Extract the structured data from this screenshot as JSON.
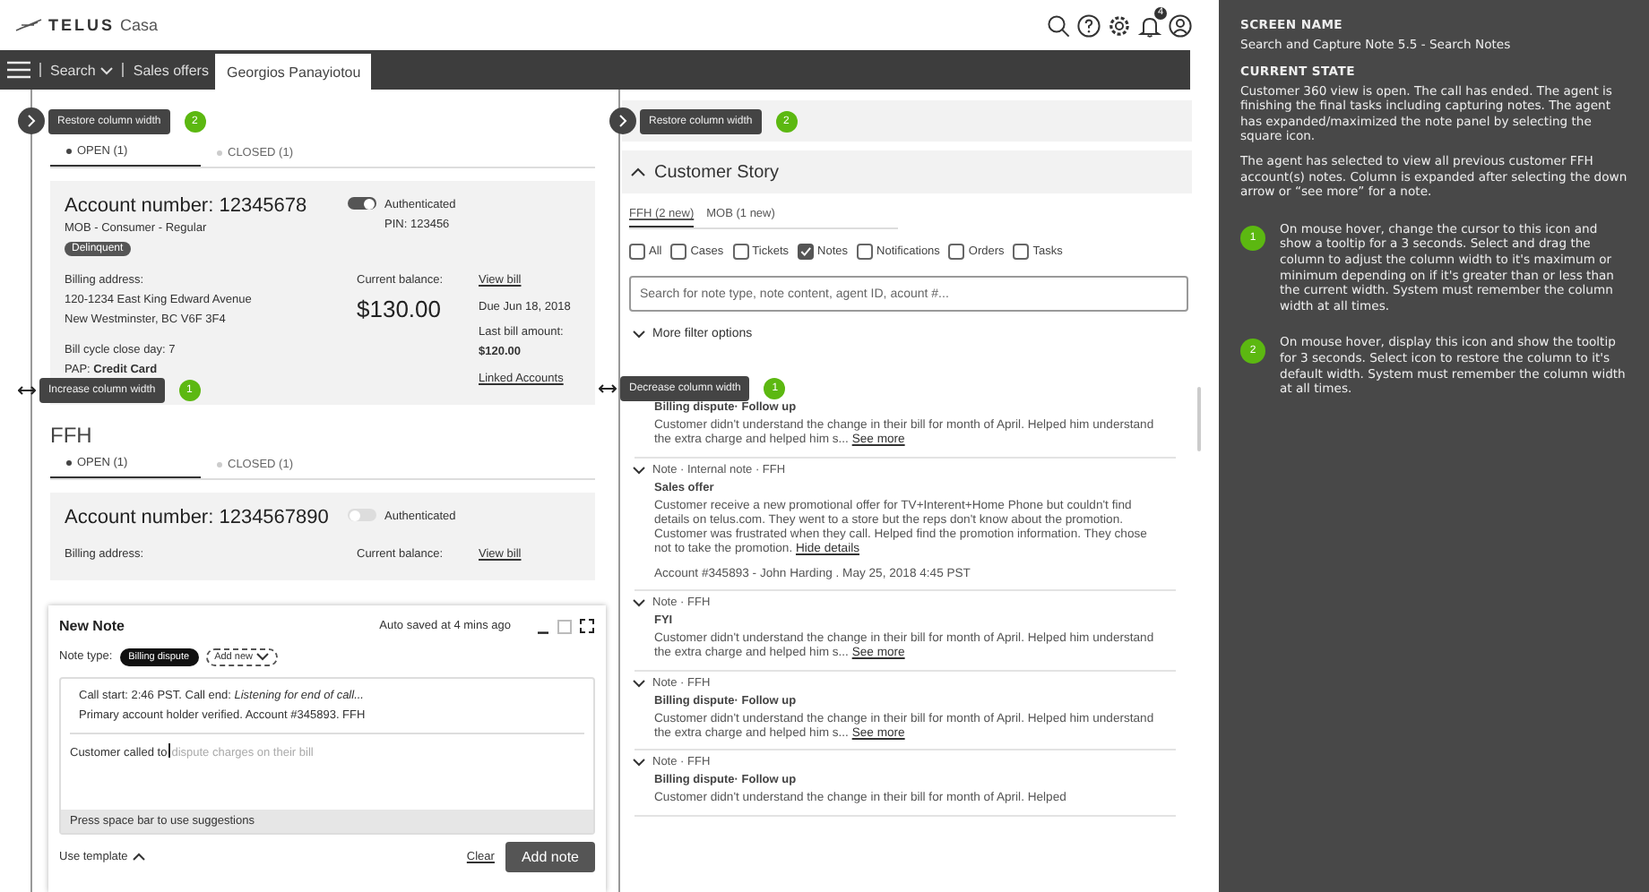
{
  "header": {
    "brand": "TELUS",
    "product": "Casa",
    "notification_count": "4"
  },
  "nav": {
    "search": "Search",
    "sales_offers": "Sales offers",
    "customer_tab": "Georgios Panayiotou"
  },
  "left_column": {
    "restore_tooltip": {
      "text": "Restore column width",
      "badge": "2"
    },
    "resize_tooltip": {
      "text": "Increase column width",
      "badge": "1"
    },
    "sections": [
      {
        "tabs": [
          {
            "label": "OPEN (1)",
            "selected": true
          },
          {
            "label": "CLOSED (1)",
            "selected": false
          }
        ],
        "account": {
          "number": "Account number: 12345678",
          "plan": "MOB - Consumer - Regular",
          "status_tag": "Delinquent",
          "authenticated": true,
          "auth_label": "Authenticated",
          "pin": "PIN: 123456",
          "billing_label": "Billing address:",
          "address": [
            "120-1234 East King Edward Avenue",
            "New Westminster, BC V6F 3F4"
          ],
          "bill_cycle": "Bill cycle close day: 7",
          "pap": "PAP: **Credit Card**",
          "balance_label": "Current balance:",
          "balance": "$130.00",
          "view_bill": "View bill",
          "due": "Due Jun 18, 2018",
          "last_bill_label": "Last bill amount:",
          "last_bill": "$120.00",
          "linked": "Linked Accounts"
        }
      },
      {
        "title": "FFH",
        "tabs": [
          {
            "label": "OPEN (1)",
            "selected": true
          },
          {
            "label": "CLOSED (1)",
            "selected": false
          }
        ],
        "account": {
          "number": "Account number: 1234567890",
          "authenticated": false,
          "auth_label": "Authenticated",
          "billing_label": "Billing address:",
          "balance_label": "Current balance:",
          "view_bill": "View bill"
        }
      }
    ],
    "new_note": {
      "title": "New Note",
      "autosave": "Auto saved at 4 mins ago",
      "note_type_label": "Note type:",
      "type_chip": "Billing dispute",
      "add_new": "Add new",
      "lines": [
        "Call start: 2:46 PST. Call end: *Listening for end of call...*",
        "Primary account holder verified. Account #345893. FFH"
      ],
      "typed": "Customer called to",
      "suggestion": "dispute charges on their bill",
      "hint": "Press space bar to use suggestions",
      "use_template": "Use template",
      "clear": "Clear",
      "add_note": "Add note"
    }
  },
  "right_column": {
    "restore_tooltip": {
      "text": "Restore column width",
      "badge": "2"
    },
    "resize_tooltip": {
      "text": "Decrease column width",
      "badge": "1"
    },
    "story": {
      "title": "Customer Story",
      "expanded": true
    },
    "tabs": [
      {
        "label": "FFH (2 new)",
        "selected": true
      },
      {
        "label": "MOB (1 new)",
        "selected": false
      }
    ],
    "filters": [
      {
        "label": "All",
        "checked": false
      },
      {
        "label": "Cases",
        "checked": false
      },
      {
        "label": "Tickets",
        "checked": false
      },
      {
        "label": "Notes",
        "checked": true
      },
      {
        "label": "Notifications",
        "checked": false
      },
      {
        "label": "Orders",
        "checked": false
      },
      {
        "label": "Tasks",
        "checked": false
      }
    ],
    "search": {
      "placeholder": "Search for note type, note content, agent ID, acount #..."
    },
    "more_filters": "More filter options",
    "notes": [
      {
        "title": "Billing dispute· Follow up",
        "text": "Customer didn't understand the change in their bill for month of April. Helped him understand the extra charge and helped him s...",
        "link": "See more"
      },
      {
        "header": "Note · Internal note · FFH",
        "title": "Sales offer",
        "text": "Customer receive a new promotional offer for TV+Interent+Home Phone but couldn't find details on telus.com. They went to a store but the reps don't know about the promotion. Customer was frustrated when they call. Helped find the promotion information. They chose not to take the promotion.",
        "link": "Hide details",
        "meta": "Account #345893 - John Harding . May 25, 2018 4:45 PST"
      },
      {
        "header": "Note · FFH",
        "title": "FYI",
        "text": "Customer didn't understand the change in their bill for month of April. Helped him understand the extra charge and helped him s...",
        "link": "See more"
      },
      {
        "header": "Note · FFH",
        "title": "Billing dispute· Follow up",
        "text": "Customer didn't understand the change in their bill for month of April. Helped him understand the extra charge and helped him s...",
        "link": "See more"
      },
      {
        "header": "Note · FFH",
        "title": "Billing dispute· Follow up",
        "text": "Customer didn't understand the change in their bill for month of April. Helped"
      }
    ]
  },
  "annotations": {
    "screen_name_label": "SCREEN NAME",
    "screen_name": "Search and Capture Note 5.5 - Search Notes",
    "current_state_label": "CURRENT STATE",
    "paragraphs": [
      "Customer 360 view is open. The call has ended. The agent is finishing the final tasks including capturing notes. The agent has expanded/maximized the note panel by selecting the square icon.",
      "The agent has selected to view all previous customer FFH account(s) notes. Column is expanded after selecting the down arrow or “see more” for a note."
    ],
    "notes": [
      {
        "badge": "1",
        "text": "On mouse hover, change the cursor to this icon and show a tooltip for a 3 seconds. Select and drag the column to adjust the column width to it's maximum or minimum depending on if it's greater than or less than the current width. System must remember the column width at all times."
      },
      {
        "badge": "2",
        "text": "On mouse hover, display this icon and show the tooltip for 3 seconds. Select icon to restore the column to it's default width. System must remember the column width at all times."
      }
    ]
  }
}
